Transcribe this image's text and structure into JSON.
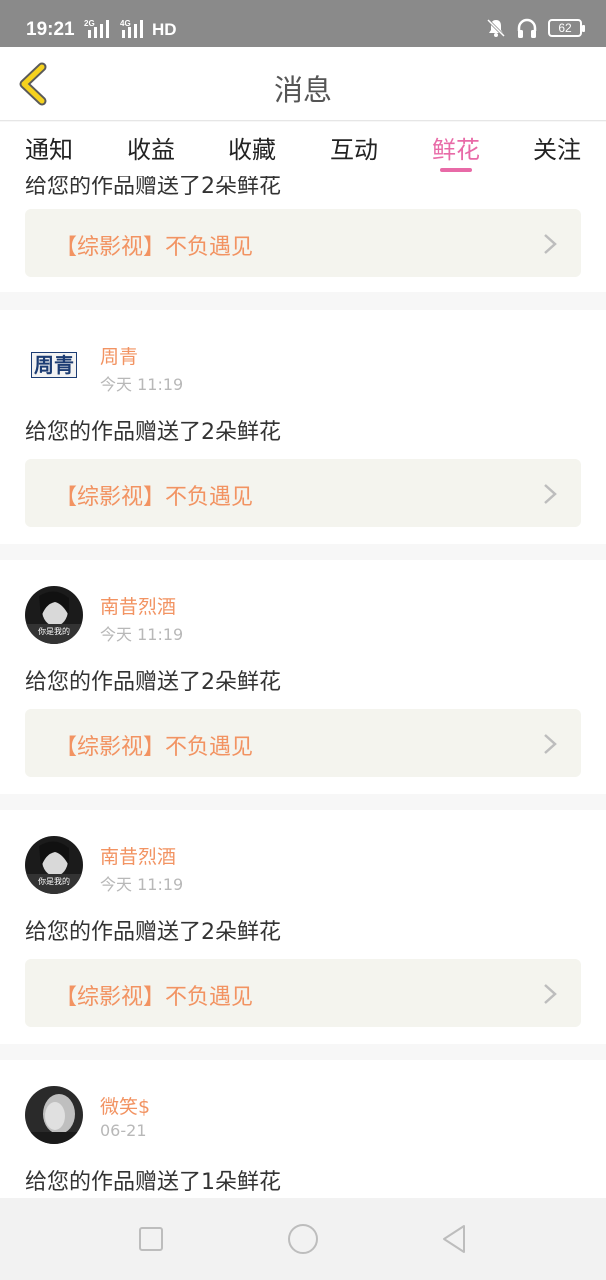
{
  "status_bar": {
    "time": "19:21",
    "network_1": "2G",
    "network_2": "4G",
    "hd": "HD",
    "battery": "62"
  },
  "header": {
    "title": "消息"
  },
  "tabs": [
    {
      "label": "通知",
      "active": false
    },
    {
      "label": "收益",
      "active": false
    },
    {
      "label": "收藏",
      "active": false
    },
    {
      "label": "互动",
      "active": false
    },
    {
      "label": "鲜花",
      "active": true
    },
    {
      "label": "关注",
      "active": false
    }
  ],
  "messages": [
    {
      "user_name": "",
      "time": "",
      "text": "给您的作品赠送了2朵鲜花",
      "work_title": "【综影视】不负遇见",
      "partial": true
    },
    {
      "user_name": "周青",
      "avatar_text": "周青",
      "time": "今天 11:19",
      "text": "给您的作品赠送了2朵鲜花",
      "work_title": "【综影视】不负遇见"
    },
    {
      "user_name": "南昔烈酒",
      "avatar_caption": "你是我的",
      "time": "今天 11:19",
      "text": "给您的作品赠送了2朵鲜花",
      "work_title": "【综影视】不负遇见"
    },
    {
      "user_name": "南昔烈酒",
      "avatar_caption": "你是我的",
      "time": "今天 11:19",
      "text": "给您的作品赠送了2朵鲜花",
      "work_title": "【综影视】不负遇见"
    },
    {
      "user_name": "微笑$",
      "time": "06-21",
      "text": "给您的作品赠送了1朵鲜花"
    }
  ],
  "colors": {
    "accent_pink": "#e86aa7",
    "name_orange": "#f29362",
    "back_arrow_yellow": "#f5d21e"
  }
}
